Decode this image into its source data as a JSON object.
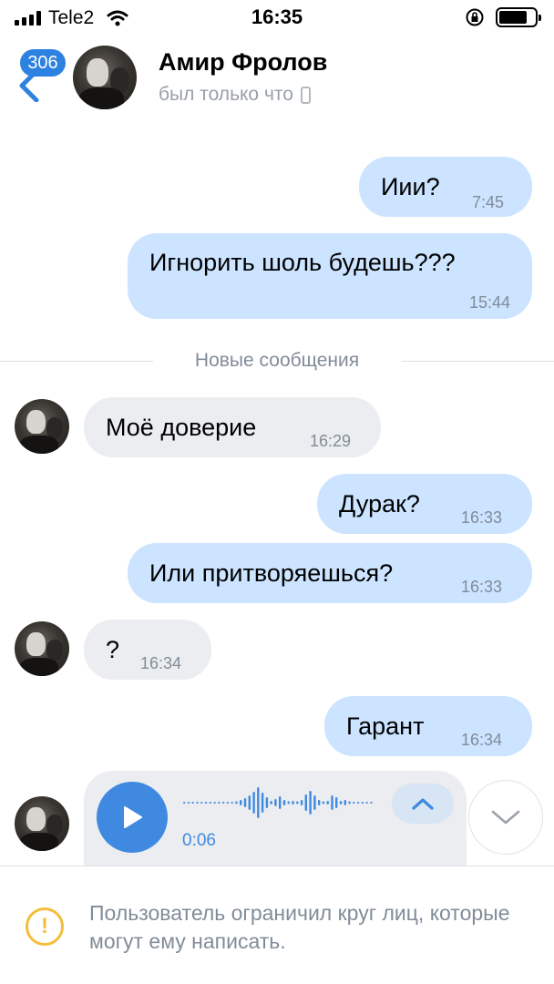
{
  "status_bar": {
    "carrier": "Tele2",
    "time": "16:35"
  },
  "header": {
    "unread_badge": "306",
    "contact_name": "Амир Фролов",
    "last_seen": "был только что",
    "last_seen_device_icon": "phone-icon"
  },
  "messages": [
    {
      "direction": "out",
      "text": "Иии?",
      "time": "7:45"
    },
    {
      "direction": "out",
      "text": "Игнорить шоль будешь???",
      "time": "15:44"
    },
    {
      "direction": "in",
      "text": "Моё доверие",
      "time": "16:29"
    },
    {
      "direction": "out",
      "text": "Дурак?",
      "time": "16:33"
    },
    {
      "direction": "out",
      "text": "Или притворяешься?",
      "time": "16:33"
    },
    {
      "direction": "in",
      "text": "?",
      "time": "16:34"
    },
    {
      "direction": "out",
      "text": "Гарант",
      "time": "16:34"
    }
  ],
  "divider": {
    "label": "Новые сообщения"
  },
  "voice_message": {
    "duration": "0:06"
  },
  "restriction": {
    "text": "Пользователь ограничил круг лиц, которые могут ему написать."
  },
  "colors": {
    "accent": "#3f8ae0",
    "badge": "#2d81e0",
    "outgoing_bubble": "#cce4ff",
    "incoming_bubble": "#ebedf0",
    "warning": "#f5be3a"
  }
}
